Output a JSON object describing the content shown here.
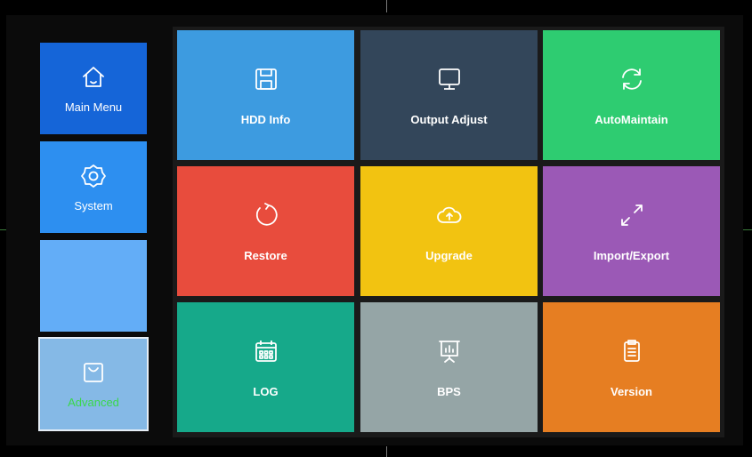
{
  "sidebar": {
    "items": [
      {
        "label": "Main Menu",
        "icon": "home-icon",
        "color": "#1565d8"
      },
      {
        "label": "System",
        "icon": "gear-icon",
        "color": "#2d8ff0"
      },
      {
        "label": "",
        "color": "#63adf7"
      },
      {
        "label": "Advanced",
        "icon": "bag-icon",
        "color": "#85b9e6",
        "label_color": "#39d84b",
        "selected": true
      }
    ]
  },
  "tiles": [
    {
      "label": "HDD Info",
      "icon": "floppy-icon",
      "color": "#3d9be0"
    },
    {
      "label": "Output Adjust",
      "icon": "monitor-icon",
      "color": "#33465a"
    },
    {
      "label": "AutoMaintain",
      "icon": "refresh-icon",
      "color": "#2ecc71"
    },
    {
      "label": "Restore",
      "icon": "restore-icon",
      "color": "#e84c3d"
    },
    {
      "label": "Upgrade",
      "icon": "cloud-upload-icon",
      "color": "#f2c311"
    },
    {
      "label": "Import/Export",
      "icon": "expand-arrows-icon",
      "color": "#9b59b6"
    },
    {
      "label": "LOG",
      "icon": "calendar-icon",
      "color": "#16a98a"
    },
    {
      "label": "BPS",
      "icon": "presentation-chart-icon",
      "color": "#95a5a6"
    },
    {
      "label": "Version",
      "icon": "clipboard-icon",
      "color": "#e67e22"
    }
  ]
}
